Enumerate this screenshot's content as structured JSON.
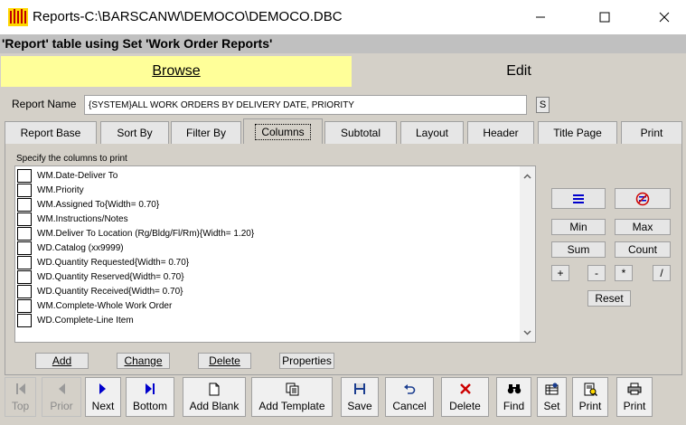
{
  "window": {
    "title": "Reports-C:\\BARSCANW\\DEMOCO\\DEMOCO.DBC",
    "subtitle": "'Report' table using Set 'Work Order Reports'"
  },
  "mode_tabs": {
    "browse": "Browse",
    "edit": "Edit"
  },
  "report_name": {
    "label": "Report Name",
    "value": "{SYSTEM}ALL WORK ORDERS BY DELIVERY DATE, PRIORITY",
    "s_button": "S"
  },
  "tabs": [
    "Report Base",
    "Sort By",
    "Filter By",
    "Columns",
    "Subtotal",
    "Layout",
    "Header",
    "Title Page",
    "Print"
  ],
  "active_tab": "Columns",
  "columns_panel": {
    "instruction": "Specify the columns to print",
    "items": [
      "WM.Date-Deliver To",
      "WM.Priority",
      "WM.Assigned To{Width= 0.70}",
      "WM.Instructions/Notes",
      "WM.Deliver To Location (Rg/Bldg/Fl/Rm){Width= 1.20}",
      "WD.Catalog (xx9999)",
      "WD.Quantity Requested{Width= 0.70}",
      "WD.Quantity Reserved{Width= 0.70}",
      "WD.Quantity Received{Width= 0.70}",
      "WM.Complete-Whole Work Order",
      "WD.Complete-Line Item"
    ],
    "buttons": {
      "add": "Add",
      "change": "Change",
      "delete": "Delete",
      "properties": "Properties"
    }
  },
  "right_panel": {
    "min": "Min",
    "max": "Max",
    "sum": "Sum",
    "count": "Count",
    "plus": "+",
    "minus": "-",
    "times": "*",
    "divide": "/",
    "reset": "Reset"
  },
  "toolbar": {
    "top": "Top",
    "prior": "Prior",
    "next": "Next",
    "bottom": "Bottom",
    "add_blank": "Add Blank",
    "add_template": "Add Template",
    "save": "Save",
    "cancel": "Cancel",
    "delete": "Delete",
    "find": "Find",
    "set": "Set",
    "print1": "Print",
    "print2": "Print"
  },
  "colors": {
    "browse_tab": "#ffff99",
    "accent_blue": "#0000cc",
    "delete_red": "#cc0000"
  }
}
